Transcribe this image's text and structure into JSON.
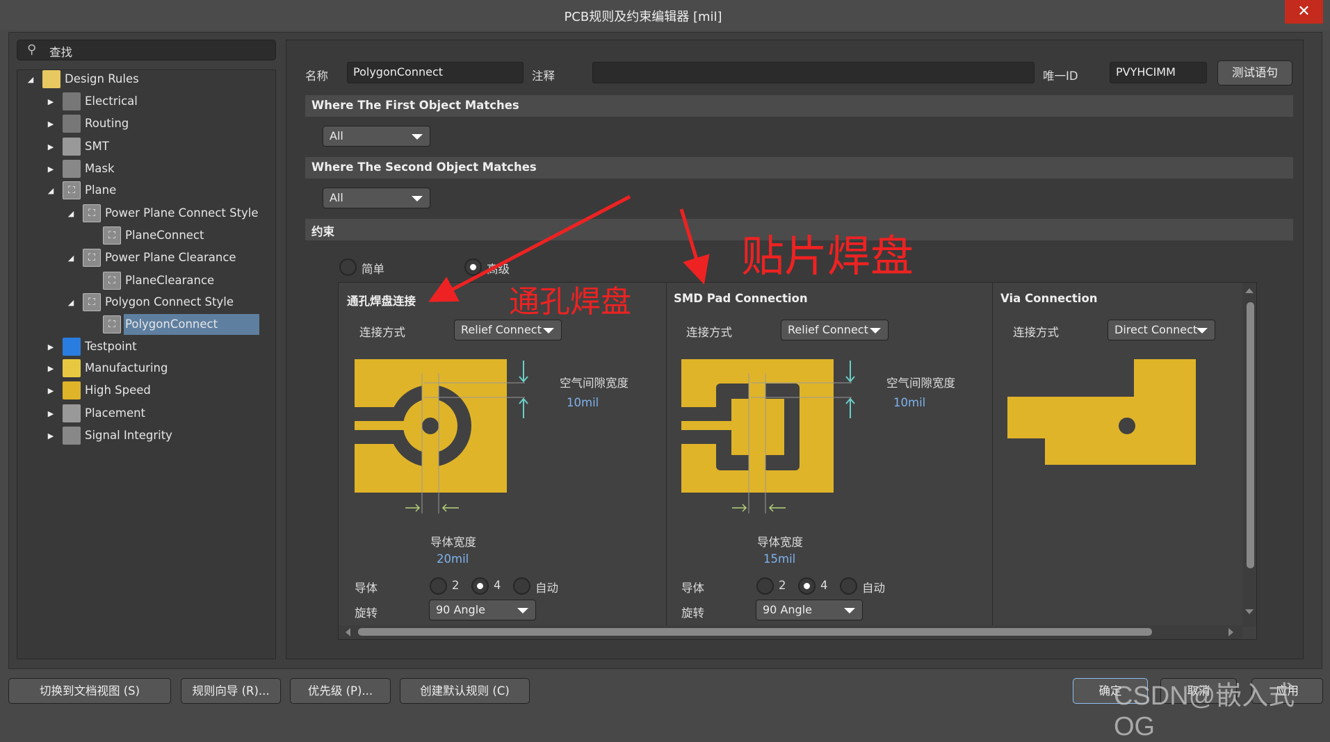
{
  "window": {
    "title": "PCB规则及约束编辑器 [mil]",
    "close_icon": "close-icon"
  },
  "search": {
    "placeholder": "查找",
    "icon": "search-icon"
  },
  "tree": [
    {
      "label": "Design Rules",
      "level": 0,
      "expanded": true,
      "icon": "design-rules-folder-icon"
    },
    {
      "label": "Electrical",
      "level": 1,
      "expanded": false,
      "icon": "electrical-icon"
    },
    {
      "label": "Routing",
      "level": 1,
      "expanded": false,
      "icon": "routing-icon"
    },
    {
      "label": "SMT",
      "level": 1,
      "expanded": false,
      "icon": "smt-icon"
    },
    {
      "label": "Mask",
      "level": 1,
      "expanded": false,
      "icon": "mask-icon"
    },
    {
      "label": "Plane",
      "level": 1,
      "expanded": true,
      "icon": "plane-icon"
    },
    {
      "label": "Power Plane Connect Style",
      "level": 2,
      "expanded": true,
      "icon": "plane-icon"
    },
    {
      "label": "PlaneConnect",
      "level": 3,
      "icon": "plane-icon"
    },
    {
      "label": "Power Plane Clearance",
      "level": 2,
      "expanded": true,
      "icon": "plane-icon"
    },
    {
      "label": "PlaneClearance",
      "level": 3,
      "icon": "plane-icon"
    },
    {
      "label": "Polygon Connect Style",
      "level": 2,
      "expanded": true,
      "icon": "plane-icon"
    },
    {
      "label": "PolygonConnect",
      "level": 3,
      "selected": true,
      "icon": "plane-icon"
    },
    {
      "label": "Testpoint",
      "level": 1,
      "expanded": false,
      "icon": "testpoint-icon"
    },
    {
      "label": "Manufacturing",
      "level": 1,
      "expanded": false,
      "icon": "manufacturing-icon"
    },
    {
      "label": "High Speed",
      "level": 1,
      "expanded": false,
      "icon": "high-speed-icon"
    },
    {
      "label": "Placement",
      "level": 1,
      "expanded": false,
      "icon": "placement-icon"
    },
    {
      "label": "Signal Integrity",
      "level": 1,
      "expanded": false,
      "icon": "signal-integrity-icon"
    }
  ],
  "rule": {
    "name_label": "名称",
    "name_value": "PolygonConnect",
    "comment_label": "注释",
    "comment_value": "",
    "id_label": "唯一ID",
    "id_value": "PVYHCIMM",
    "test_button": "测试语句",
    "first_match": {
      "header": "Where The First Object Matches",
      "value": "All"
    },
    "second_match": {
      "header": "Where The Second Object Matches",
      "value": "All"
    },
    "constraints_header": "约束",
    "mode": {
      "simple": "简单",
      "advanced": "高级",
      "selected": "advanced"
    }
  },
  "columns": [
    {
      "title": "通孔焊盘连接",
      "conn_label": "连接方式",
      "conn_value": "Relief Connect",
      "air_gap_label": "空气间隙宽度",
      "air_gap_value": "10mil",
      "width_label": "导体宽度",
      "width_value": "20mil",
      "conductors_label": "导体",
      "conductor_options": [
        "2",
        "4",
        "自动"
      ],
      "conductor_selected": "4",
      "rotation_label": "旋转",
      "rotation_value": "90 Angle"
    },
    {
      "title": "SMD Pad Connection",
      "conn_label": "连接方式",
      "conn_value": "Relief Connect",
      "air_gap_label": "空气间隙宽度",
      "air_gap_value": "10mil",
      "width_label": "导体宽度",
      "width_value": "15mil",
      "conductors_label": "导体",
      "conductor_options": [
        "2",
        "4",
        "自动"
      ],
      "conductor_selected": "4",
      "rotation_label": "旋转",
      "rotation_value": "90 Angle"
    },
    {
      "title": "Via Connection",
      "conn_label": "连接方式",
      "conn_value": "Direct Connect"
    }
  ],
  "annotations": {
    "through_hole": "通孔焊盘",
    "smd": "贴片焊盘",
    "color": "#ee2222"
  },
  "colors": {
    "copper": "#e0b429",
    "selection": "#5e7fa0",
    "close": "#c42b1c"
  },
  "footer": {
    "doc_view": "切换到文档视图 (S)",
    "wizard": "规则向导 (R)...",
    "priority": "优先级 (P)...",
    "create_default": "创建默认规则 (C)",
    "ok": "确定",
    "cancel": "取消",
    "apply": "应用"
  },
  "watermark": "CSDN@嵌入式OG"
}
